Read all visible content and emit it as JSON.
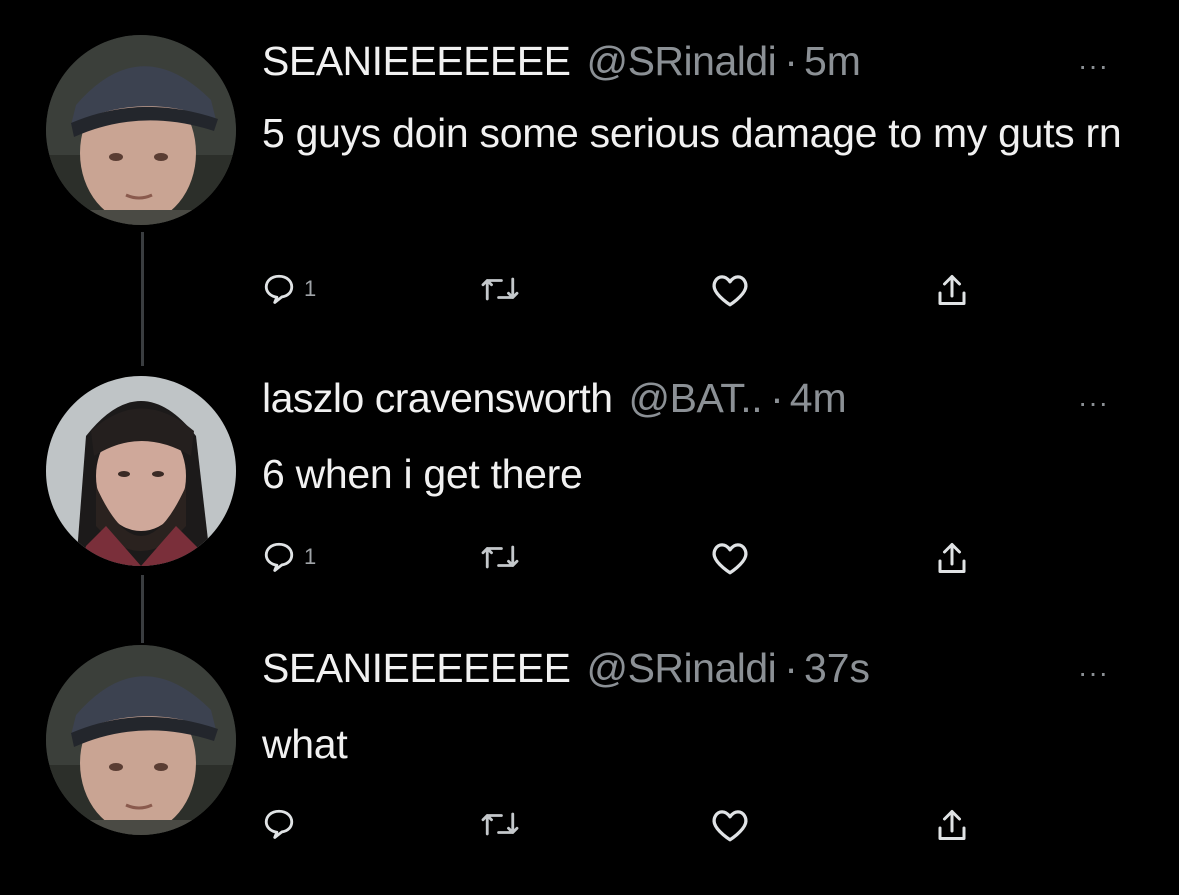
{
  "tweets": [
    {
      "name": "SEANIEEEEEEE",
      "handle": "@SRinaldi",
      "time": "5m",
      "more": "···",
      "text": "5 guys doin some serious damage to my guts rn",
      "reply_count": "1",
      "avatar": "man-in-cap-avatar"
    },
    {
      "name": "laszlo cravensworth",
      "handle": "@BAT..",
      "time": "4m",
      "more": "···",
      "text": "6 when i get there",
      "reply_count": "1",
      "avatar": "bearded-man-avatar"
    },
    {
      "name": "SEANIEEEEEEE",
      "handle": "@SRinaldi",
      "time": "37s",
      "more": "···",
      "text": "what",
      "reply_count": "",
      "avatar": "man-in-cap-avatar"
    }
  ],
  "separator": "·",
  "colors": {
    "background": "#000000",
    "text": "#f1f1f1",
    "muted": "#8b9095",
    "thread_line": "#3a3d40"
  },
  "icons": [
    "reply-icon",
    "retweet-icon",
    "like-icon",
    "share-icon"
  ]
}
